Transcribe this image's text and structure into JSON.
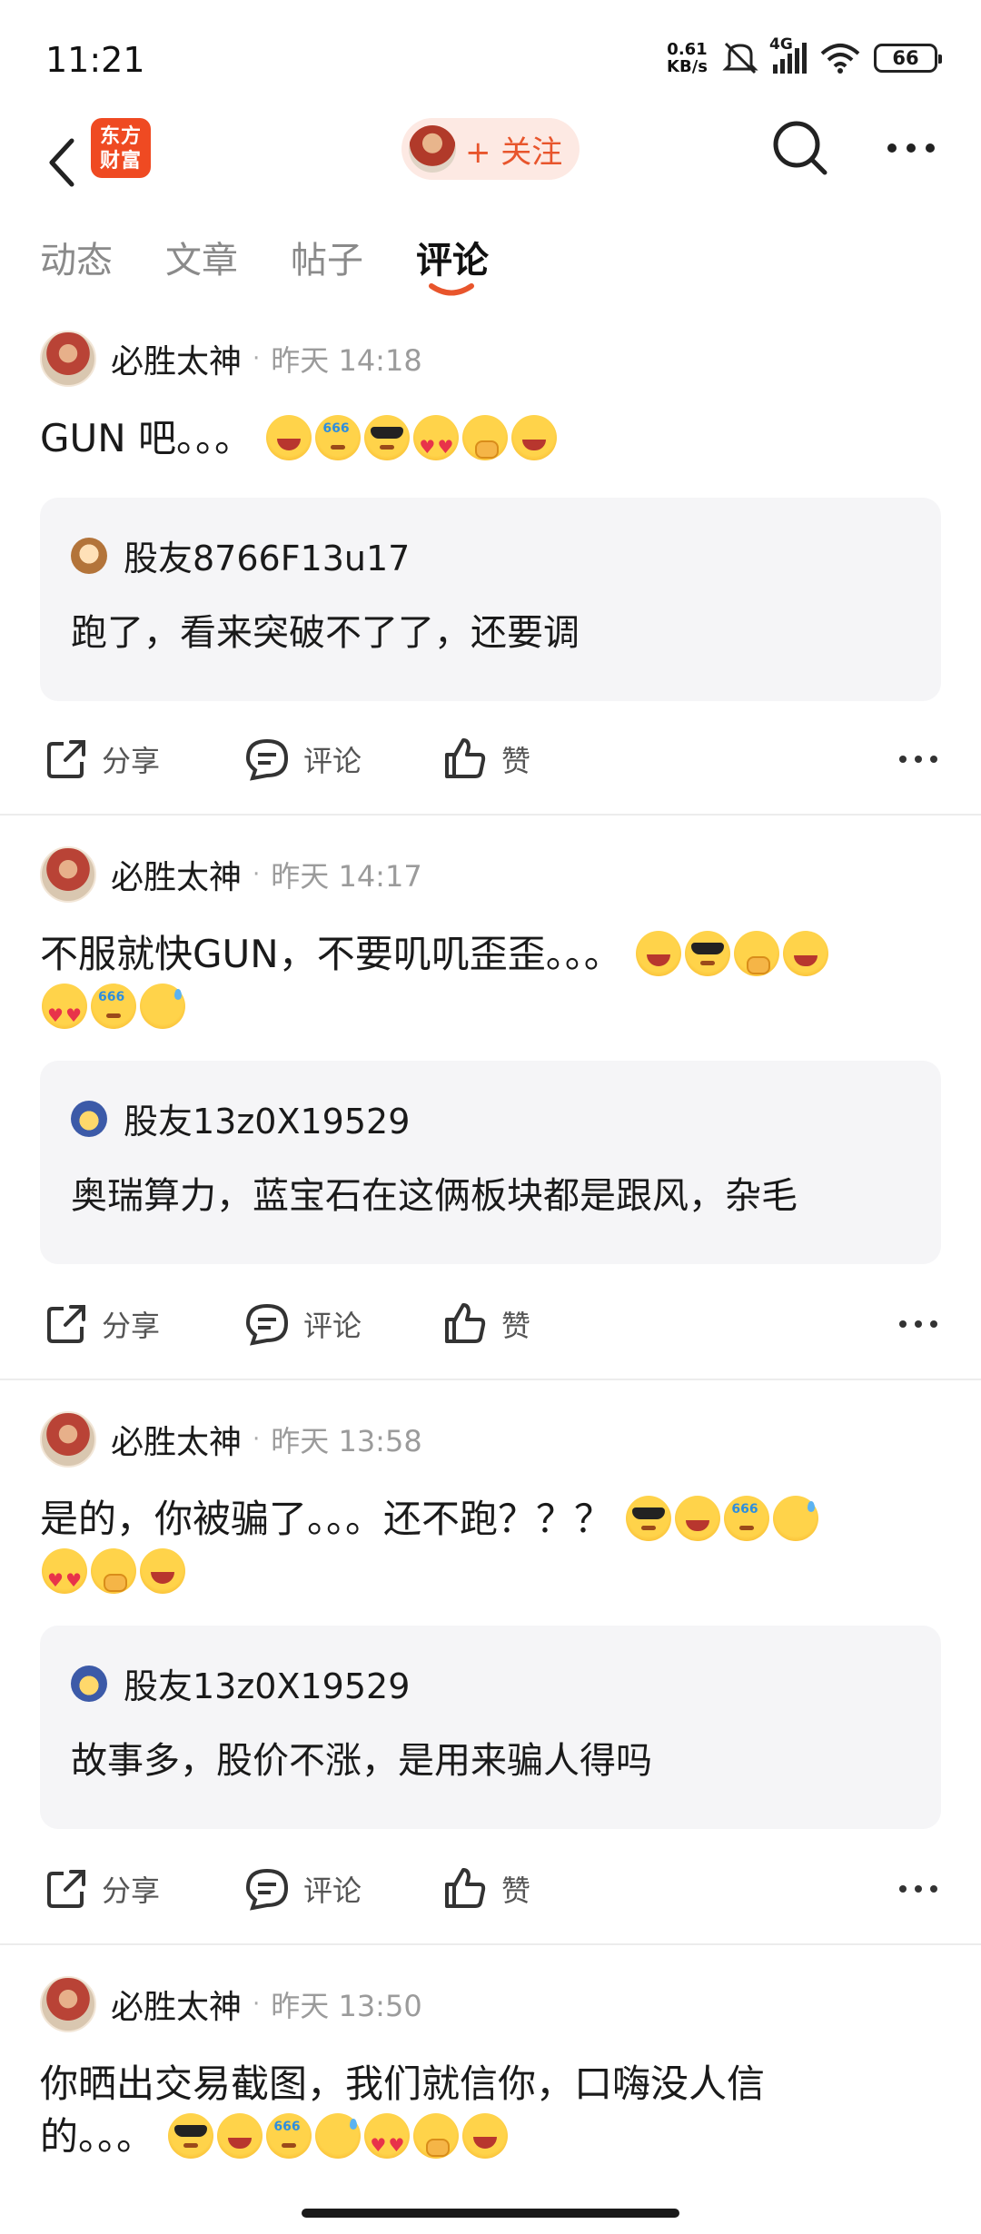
{
  "status_bar": {
    "time": "11:21",
    "net_speed_top": "0.61",
    "net_speed_bottom": "KB/s",
    "network": "4G",
    "battery": "66"
  },
  "header": {
    "logo_line1": "东方",
    "logo_line2": "财富",
    "follow_label": "+ 关注"
  },
  "tabs": [
    {
      "label": "动态"
    },
    {
      "label": "文章"
    },
    {
      "label": "帖子"
    },
    {
      "label": "评论",
      "active": true
    }
  ],
  "posts": [
    {
      "author": "必胜太神",
      "time": "昨天 14:18",
      "text_line1": "GUN 吧。。。",
      "text_line2": "",
      "emojis_line1": [
        "laugh",
        "think",
        "cool",
        "love",
        "shy",
        "grin"
      ],
      "emojis_line2": [],
      "quote_user": "股友8766F13u17",
      "quote_text": "跑了，看来突破不了了，还要调"
    },
    {
      "author": "必胜太神",
      "time": "昨天 14:17",
      "text_line1": "不服就快GUN，不要叽叽歪歪。。。",
      "text_line2": "",
      "emojis_line1": [
        "laugh",
        "cool",
        "shy",
        "grin"
      ],
      "emojis_line2": [
        "love",
        "think",
        "sweat"
      ],
      "quote_user": "股友13z0X19529",
      "quote_text": "奥瑞算力，蓝宝石在这俩板块都是跟风，杂毛"
    },
    {
      "author": "必胜太神",
      "time": "昨天 13:58",
      "text_line1": "是的，你被骗了。。。还不跑？？？",
      "text_line2": "",
      "emojis_line1": [
        "cool",
        "grin",
        "think",
        "sweat"
      ],
      "emojis_line2": [
        "love",
        "shy",
        "laugh"
      ],
      "quote_user": "股友13z0X19529",
      "quote_text": "故事多，股价不涨，是用来骗人得吗"
    },
    {
      "author": "必胜太神",
      "time": "昨天 13:50",
      "text_line1": "你晒出交易截图，我们就信你，口嗨没人信",
      "text_line2": "的。。。",
      "emojis_line1": [],
      "emojis_line2": [
        "cool",
        "grin",
        "think",
        "sweat",
        "love",
        "shy",
        "laugh"
      ]
    }
  ],
  "actions": {
    "share": "分享",
    "comment": "评论",
    "like": "赞"
  },
  "colors": {
    "accent": "#e8552c",
    "logo": "#ef4a22",
    "quote_bg": "#f5f5f7"
  }
}
